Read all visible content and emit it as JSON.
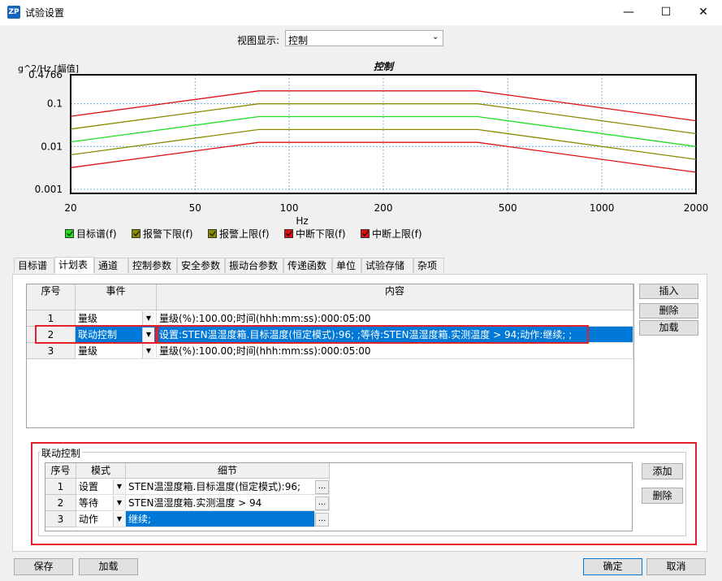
{
  "window": {
    "title": "试验设置",
    "minimize": "—",
    "maximize": "☐",
    "close": "✕"
  },
  "view": {
    "label": "视图显示:",
    "selected": "控制"
  },
  "chart_data": {
    "type": "line",
    "title": "控制",
    "ylabel": "g^2/Hz [幅值]",
    "xlabel": "Hz",
    "xscale": "log",
    "yscale": "log",
    "xlim": [
      20,
      2000
    ],
    "ylim": [
      0.0008,
      0.4766
    ],
    "x_ticks": [
      "20",
      "50",
      "100",
      "200",
      "500",
      "1000",
      "2000"
    ],
    "y_ticks": [
      "0.4766",
      "0.1",
      "0.01",
      "0.001"
    ],
    "grid": true,
    "series": [
      {
        "name": "目标谱(f)",
        "color": "#22dd22",
        "x": [
          20,
          80,
          400,
          2000
        ],
        "y": [
          0.0128,
          0.05,
          0.05,
          0.01
        ]
      },
      {
        "name": "报警下限(f)",
        "color": "#8a8a00",
        "x": [
          20,
          80,
          400,
          2000
        ],
        "y": [
          0.0064,
          0.025,
          0.025,
          0.005
        ]
      },
      {
        "name": "报警上限(f)",
        "color": "#8a8a00",
        "x": [
          20,
          80,
          400,
          2000
        ],
        "y": [
          0.0256,
          0.1,
          0.1,
          0.02
        ]
      },
      {
        "name": "中断下限(f)",
        "color": "#dd1111",
        "x": [
          20,
          80,
          400,
          2000
        ],
        "y": [
          0.0032,
          0.0125,
          0.0125,
          0.0025
        ]
      },
      {
        "name": "中断上限(f)",
        "color": "#dd1111",
        "x": [
          20,
          80,
          400,
          2000
        ],
        "y": [
          0.051,
          0.2,
          0.2,
          0.04
        ]
      }
    ]
  },
  "legend_colors": [
    "#22dd22",
    "#8a8a00",
    "#8a8a00",
    "#dd1111",
    "#dd1111"
  ],
  "tabs": [
    "目标谱",
    "计划表",
    "通道",
    "控制参数",
    "安全参数",
    "振动台参数",
    "传递函数",
    "单位",
    "试验存储",
    "杂项"
  ],
  "active_tab": "计划表",
  "schedule": {
    "headers": {
      "index": "序号",
      "event": "事件",
      "content": "内容"
    },
    "rows": [
      {
        "index": "1",
        "event": "量级",
        "content": "量级(%):100.00;时间(hhh:mm:ss):000:05:00"
      },
      {
        "index": "2",
        "event": "联动控制",
        "content": "设置:STEN温湿度箱.目标温度(恒定模式):96; ;等待:STEN温湿度箱.实测温度 > 94;动作:继续; ;"
      },
      {
        "index": "3",
        "event": "量级",
        "content": "量级(%):100.00;时间(hhh:mm:ss):000:05:00"
      }
    ],
    "buttons": {
      "insert": "插入",
      "delete": "删除",
      "load": "加载"
    }
  },
  "linkage": {
    "group_title": "联动控制",
    "headers": {
      "index": "序号",
      "mode": "模式",
      "detail": "细节"
    },
    "rows": [
      {
        "index": "1",
        "mode": "设置",
        "detail": "STEN温湿度箱.目标温度(恒定模式):96;"
      },
      {
        "index": "2",
        "mode": "等待",
        "detail": "STEN温湿度箱.实测温度 > 94"
      },
      {
        "index": "3",
        "mode": "动作",
        "detail": "继续;"
      }
    ],
    "ellipsis": "...",
    "buttons": {
      "add": "添加",
      "delete": "删除"
    }
  },
  "footer": {
    "save": "保存",
    "load": "加载",
    "ok": "确定",
    "cancel": "取消"
  }
}
